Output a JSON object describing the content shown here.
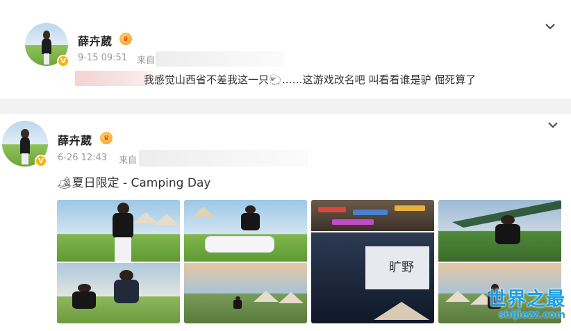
{
  "posts": [
    {
      "author": "薛卉葳",
      "time": "9-15 09:51",
      "source_prefix": "来自",
      "text": "我感觉山西省不差我这一只🐑……这游戏改名吧 叫看看谁是驴 倔死算了",
      "verified_badge": "V",
      "crown_icon": "crown-badge-icon"
    },
    {
      "author": "薛卉葳",
      "time": "6-26 12:43",
      "source_prefix": "来自",
      "text": "🏕夏日限定 - Camping Day",
      "verified_badge": "V",
      "crown_icon": "crown-badge-icon",
      "photos": [
        {
          "name": "grass-lawn-photo"
        },
        {
          "name": "go-kart-photo"
        },
        {
          "name": "tent-snacks-screen-photo"
        },
        {
          "name": "camp-shade-photo"
        }
      ],
      "screen_text": "旷野"
    }
  ],
  "watermark": {
    "cn": "世界之最",
    "en": "shijiezz.com"
  },
  "colors": {
    "gold": "#ffb300",
    "gap": "#f2f2f2",
    "watermark": "#1aa0e8"
  }
}
